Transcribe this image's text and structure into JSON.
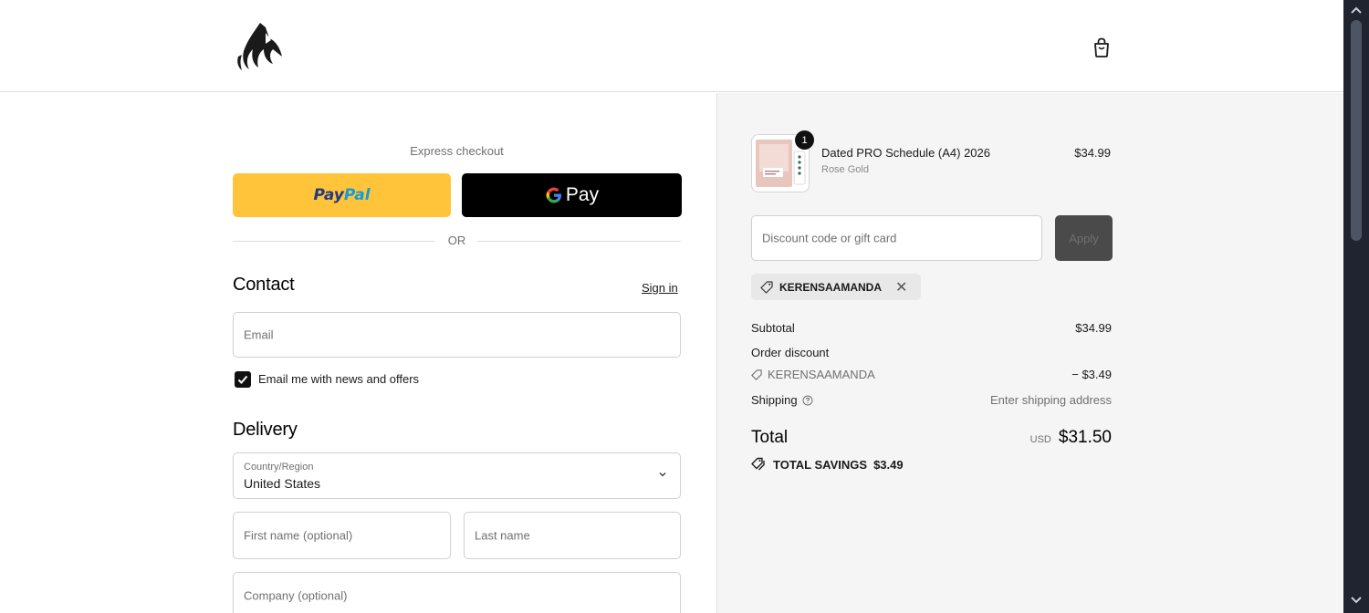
{
  "header": {
    "logo": "fox-logo",
    "cart_icon": "shopping-bag-icon"
  },
  "express": {
    "label": "Express checkout",
    "paypal": {
      "pay1": "Pay",
      "pay2": "Pal"
    },
    "gpay": {
      "g": "G",
      "pay": "Pay"
    },
    "or": "OR"
  },
  "contact": {
    "title": "Contact",
    "sign_in": "Sign in",
    "email_placeholder": "Email",
    "newsletter_label": "Email me with news and offers",
    "newsletter_checked": true
  },
  "delivery": {
    "title": "Delivery",
    "country_label": "Country/Region",
    "country_value": "United States",
    "first_name_placeholder": "First name (optional)",
    "last_name_placeholder": "Last name",
    "company_placeholder": "Company (optional)"
  },
  "order": {
    "item": {
      "name": "Dated PRO Schedule (A4) 2026",
      "variant": "Rose Gold",
      "price": "$34.99",
      "quantity": "1"
    },
    "discount_placeholder": "Discount code or gift card",
    "apply_label": "Apply",
    "applied_code": "KERENSAAMANDA",
    "subtotal_label": "Subtotal",
    "subtotal_value": "$34.99",
    "order_discount_label": "Order discount",
    "discount_code": "KERENSAAMANDA",
    "discount_value": "− $3.49",
    "shipping_label": "Shipping",
    "shipping_value": "Enter shipping address",
    "total_label": "Total",
    "currency": "USD",
    "total_value": "$31.50",
    "savings_label": "TOTAL SAVINGS",
    "savings_value": "$3.49"
  },
  "colors": {
    "paypal": "#ffc439",
    "gpay": "#000000",
    "right_panel": "#f5f5f5",
    "apply_button": "#4a4a4a"
  }
}
